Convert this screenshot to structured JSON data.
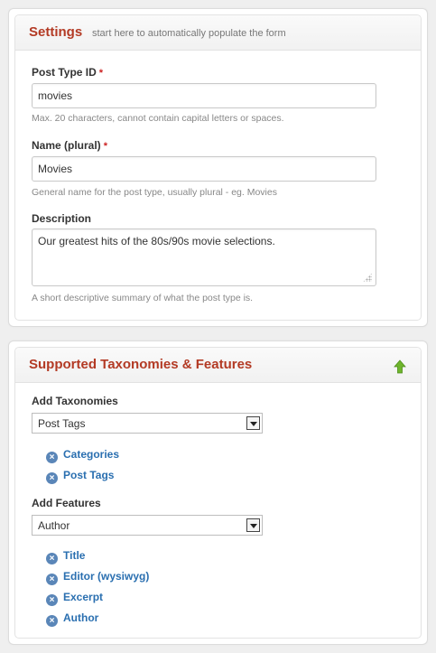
{
  "settings": {
    "title": "Settings",
    "hint": "start here to automatically populate the form",
    "post_type_id": {
      "label": "Post Type ID",
      "required": "*",
      "value": "movies",
      "help": "Max. 20 characters, cannot contain capital letters or spaces."
    },
    "name_plural": {
      "label": "Name (plural)",
      "required": "*",
      "value": "Movies",
      "help": "General name for the post type, usually plural - eg. Movies"
    },
    "description": {
      "label": "Description",
      "value": "Our greatest hits of the 80s/90s movie selections.",
      "help": "A short descriptive summary of what the post type is."
    }
  },
  "taxonomies_features": {
    "title": "Supported Taxonomies & Features",
    "add_taxonomies": {
      "label": "Add Taxonomies",
      "selected": "Post Tags",
      "items": [
        "Categories",
        "Post Tags"
      ]
    },
    "add_features": {
      "label": "Add Features",
      "selected": "Author",
      "items": [
        "Title",
        "Editor (wysiwyg)",
        "Excerpt",
        "Author"
      ]
    }
  },
  "colors": {
    "title_red": "#b33a24",
    "link_blue": "#2a6fb0",
    "icon_green": "#6fb52c"
  }
}
